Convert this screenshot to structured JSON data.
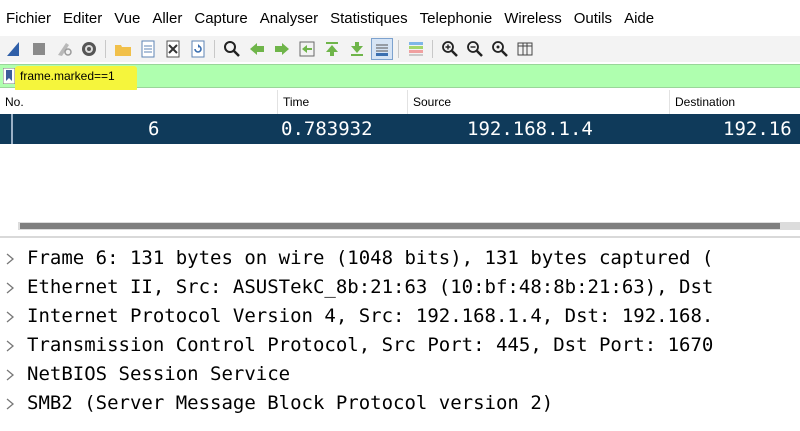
{
  "menu": [
    "Fichier",
    "Editer",
    "Vue",
    "Aller",
    "Capture",
    "Analyser",
    "Statistiques",
    "Telephonie",
    "Wireless",
    "Outils",
    "Aide"
  ],
  "toolbar": {
    "icons": [
      "shark-fin-icon",
      "stop-icon",
      "restart-icon",
      "options-gear-icon",
      "open-folder-icon",
      "save-file-icon",
      "close-file-icon",
      "reload-icon",
      "find-icon",
      "go-back-icon",
      "go-forward-icon",
      "go-to-packet-icon",
      "first-packet-icon",
      "last-packet-icon",
      "autoscroll-icon",
      "colorize-icon",
      "zoom-in-icon",
      "zoom-out-icon",
      "normal-size-icon",
      "resize-columns-icon"
    ]
  },
  "filter": {
    "value": "frame.marked==1"
  },
  "packet_list": {
    "columns": [
      "No.",
      "Time",
      "Source",
      "Destination"
    ],
    "rows": [
      {
        "no": "6",
        "time": "0.783932",
        "source": "192.168.1.4",
        "destination": "192.16"
      }
    ]
  },
  "details": [
    "Frame 6: 131 bytes on wire (1048 bits), 131 bytes captured (",
    "Ethernet II, Src: ASUSTekC_8b:21:63 (10:bf:48:8b:21:63), Dst",
    "Internet Protocol Version 4, Src: 192.168.1.4, Dst: 192.168.",
    "Transmission Control Protocol, Src Port: 445, Dst Port: 1670",
    "NetBIOS Session Service",
    "SMB2 (Server Message Block Protocol version 2)"
  ],
  "colors": {
    "filter_valid_bg": "#afffaf",
    "filter_highlight": "#f5f53c",
    "selected_row_bg": "#0f3a5a"
  }
}
